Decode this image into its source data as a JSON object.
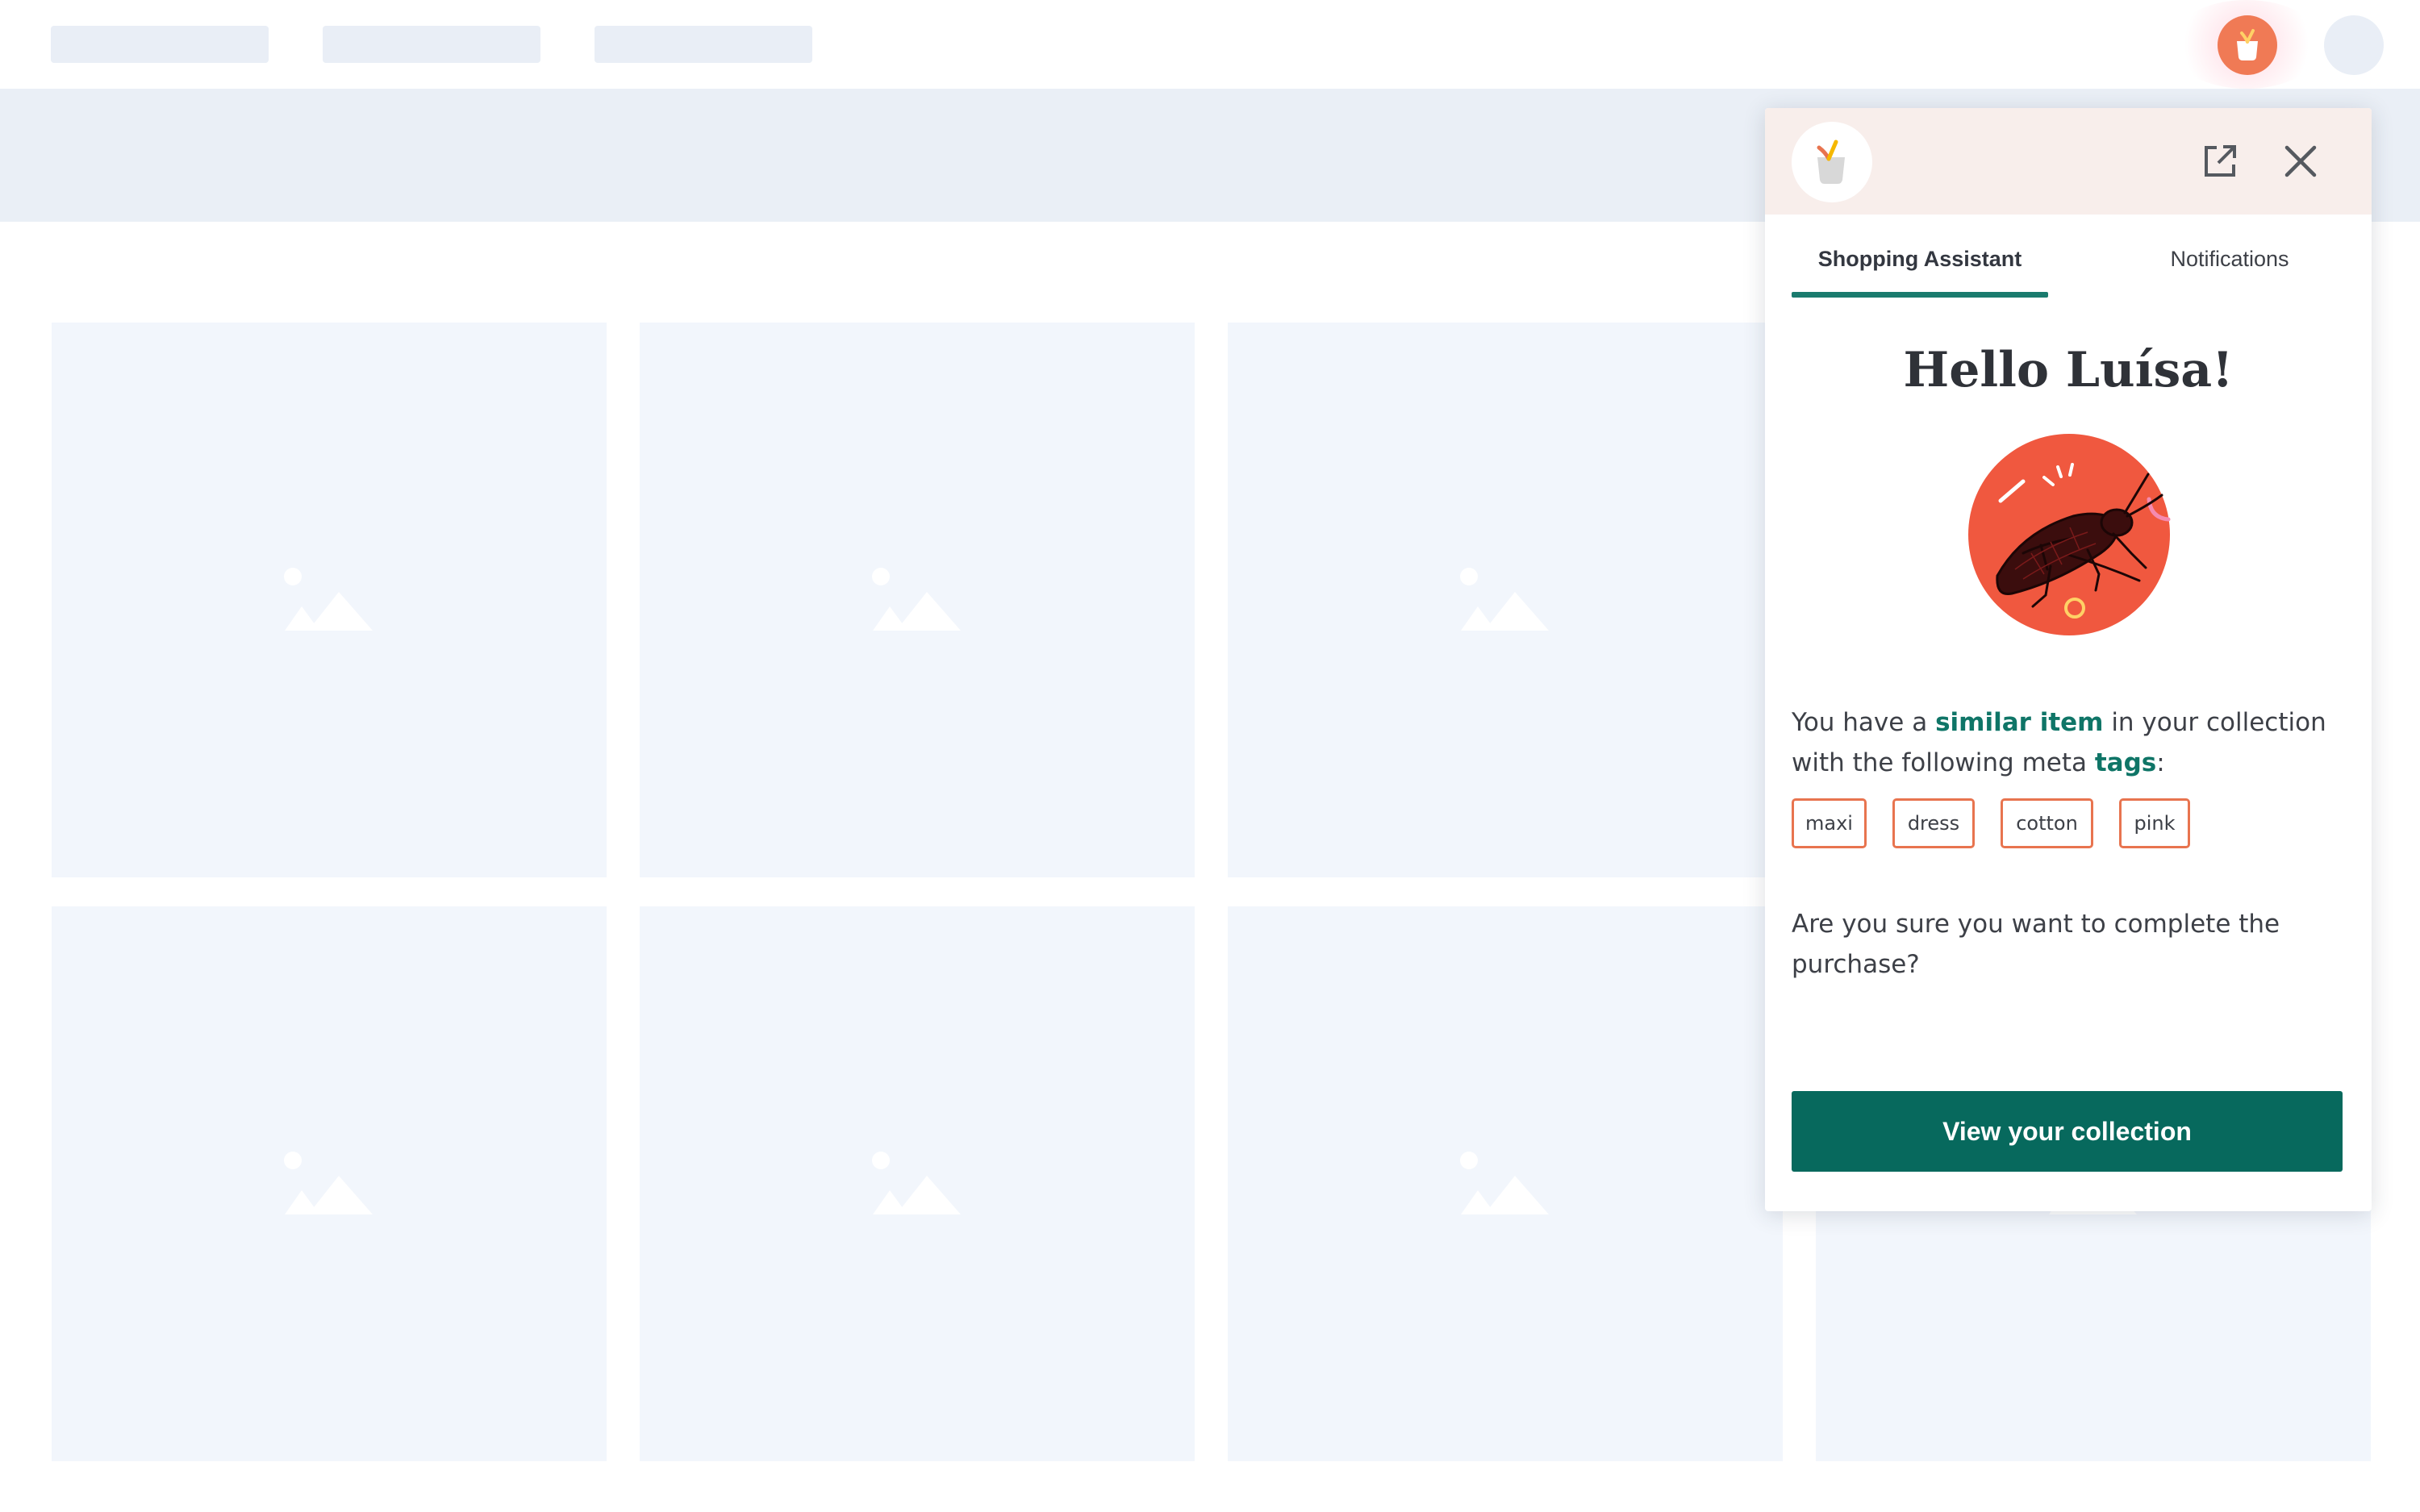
{
  "panel": {
    "tabs": [
      {
        "label": "Shopping Assistant",
        "active": true
      },
      {
        "label": "Notifications",
        "active": false
      }
    ],
    "greeting": "Hello Luísa!",
    "message": {
      "part1": "You have a ",
      "highlight1": "similar item",
      "part2": " in your collection with the following meta ",
      "highlight2": "tags",
      "part3": ":"
    },
    "tags": [
      "maxi",
      "dress",
      "cotton",
      "pink"
    ],
    "question": "Are you sure you want to complete the purchase?",
    "cta_label": "View your collection",
    "icons": {
      "logo": "cart-logo-icon",
      "open_external": "external-link-icon",
      "close": "close-icon",
      "illustration": "cricket-illustration-icon",
      "placeholder": "image-placeholder-icon"
    }
  },
  "colors": {
    "accent": "#07695d",
    "link": "#0f7567",
    "tag_border": "#e8744f",
    "brand_orange": "#f07a55",
    "placeholder_bg": "#f2f6fc",
    "panel_header_bg": "#f8eeeb"
  }
}
